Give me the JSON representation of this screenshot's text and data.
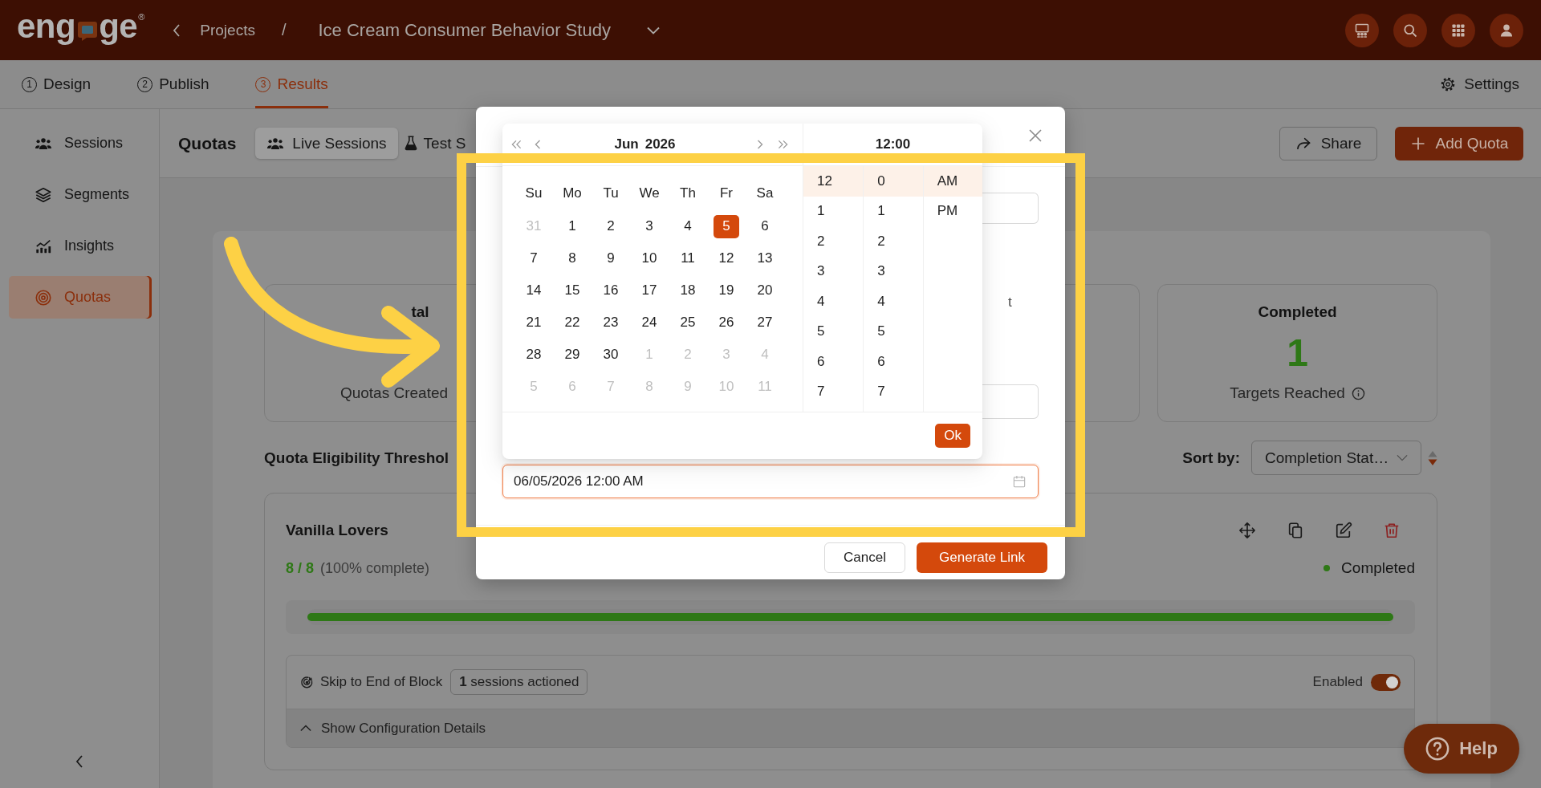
{
  "header": {
    "logo": {
      "before": "eng",
      "after": "ge",
      "mark": "®"
    },
    "breadcrumb": {
      "parent": "Projects",
      "separator": "/",
      "project": "Ice Cream Consumer Behavior Study"
    }
  },
  "steps": [
    {
      "number": "1",
      "label": "Design",
      "selected": false
    },
    {
      "number": "2",
      "label": "Publish",
      "selected": false
    },
    {
      "number": "3",
      "label": "Results",
      "selected": true
    }
  ],
  "settings": {
    "label": "Settings"
  },
  "sidebar": {
    "items": [
      {
        "label": "Sessions",
        "selected": false
      },
      {
        "label": "Segments",
        "selected": false
      },
      {
        "label": "Insights",
        "selected": false
      },
      {
        "label": "Quotas",
        "selected": true
      }
    ]
  },
  "toolbar": {
    "title": "Quotas",
    "session_tabs": [
      {
        "label": "Live Sessions",
        "selected": true
      },
      {
        "label": "Test S",
        "selected": false
      }
    ],
    "share": "Share",
    "add": "Add Quota"
  },
  "stats": [
    {
      "title": "tal",
      "subtitle": "Quotas Created",
      "info": false
    },
    {
      "title": "Completed",
      "value": "1",
      "subtitle": "Targets Reached",
      "info": true
    }
  ],
  "threshold": {
    "label": "Quota Eligibility Threshol"
  },
  "sort": {
    "label": "Sort by:",
    "value": "Completion Stat…"
  },
  "quotas": [
    {
      "name": "Vanilla Lovers",
      "count": "8 / 8",
      "percent": "(100% complete)",
      "status": {
        "label": "Completed",
        "kind": "completed"
      },
      "level": 1,
      "rule": {
        "action": "Skip to End of Block",
        "badge": "**1** sessions actioned",
        "toggle_label": "Enabled",
        "on": true
      },
      "details": "Show Configuration Details"
    }
  ],
  "help": "Help",
  "dialog": {
    "field_label": "t",
    "date_value": "06/05/2026 12:00 AM",
    "cancel": "Cancel",
    "submit": "Generate Link"
  },
  "date_picker": {
    "month": "Jun",
    "year": "2026",
    "time": "12:00",
    "weekdays": [
      "Su",
      "Mo",
      "Tu",
      "We",
      "Th",
      "Fr",
      "Sa"
    ],
    "weeks": [
      [
        {
          "day": "31",
          "in_month": false,
          "selected": false
        },
        {
          "day": "1",
          "in_month": true,
          "selected": false
        },
        {
          "day": "2",
          "in_month": true,
          "selected": false
        },
        {
          "day": "3",
          "in_month": true,
          "selected": false
        },
        {
          "day": "4",
          "in_month": true,
          "selected": false
        },
        {
          "day": "5",
          "in_month": true,
          "selected": true
        },
        {
          "day": "6",
          "in_month": true,
          "selected": false
        }
      ],
      [
        {
          "day": "7",
          "in_month": true,
          "selected": false
        },
        {
          "day": "8",
          "in_month": true,
          "selected": false
        },
        {
          "day": "9",
          "in_month": true,
          "selected": false
        },
        {
          "day": "10",
          "in_month": true,
          "selected": false
        },
        {
          "day": "11",
          "in_month": true,
          "selected": false
        },
        {
          "day": "12",
          "in_month": true,
          "selected": false
        },
        {
          "day": "13",
          "in_month": true,
          "selected": false
        }
      ],
      [
        {
          "day": "14",
          "in_month": true,
          "selected": false
        },
        {
          "day": "15",
          "in_month": true,
          "selected": false
        },
        {
          "day": "16",
          "in_month": true,
          "selected": false
        },
        {
          "day": "17",
          "in_month": true,
          "selected": false
        },
        {
          "day": "18",
          "in_month": true,
          "selected": false
        },
        {
          "day": "19",
          "in_month": true,
          "selected": false
        },
        {
          "day": "20",
          "in_month": true,
          "selected": false
        }
      ],
      [
        {
          "day": "21",
          "in_month": true,
          "selected": false
        },
        {
          "day": "22",
          "in_month": true,
          "selected": false
        },
        {
          "day": "23",
          "in_month": true,
          "selected": false
        },
        {
          "day": "24",
          "in_month": true,
          "selected": false
        },
        {
          "day": "25",
          "in_month": true,
          "selected": false
        },
        {
          "day": "26",
          "in_month": true,
          "selected": false
        },
        {
          "day": "27",
          "in_month": true,
          "selected": false
        }
      ],
      [
        {
          "day": "28",
          "in_month": true,
          "selected": false
        },
        {
          "day": "29",
          "in_month": true,
          "selected": false
        },
        {
          "day": "30",
          "in_month": true,
          "selected": false
        },
        {
          "day": "1",
          "in_month": false,
          "selected": false
        },
        {
          "day": "2",
          "in_month": false,
          "selected": false
        },
        {
          "day": "3",
          "in_month": false,
          "selected": false
        },
        {
          "day": "4",
          "in_month": false,
          "selected": false
        }
      ],
      [
        {
          "day": "5",
          "in_month": false,
          "selected": false
        },
        {
          "day": "6",
          "in_month": false,
          "selected": false
        },
        {
          "day": "7",
          "in_month": false,
          "selected": false
        },
        {
          "day": "8",
          "in_month": false,
          "selected": false
        },
        {
          "day": "9",
          "in_month": false,
          "selected": false
        },
        {
          "day": "10",
          "in_month": false,
          "selected": false
        },
        {
          "day": "11",
          "in_month": false,
          "selected": false
        }
      ]
    ],
    "hours": [
      {
        "label": "12",
        "selected": true
      },
      {
        "label": "1",
        "selected": false
      },
      {
        "label": "2",
        "selected": false
      },
      {
        "label": "3",
        "selected": false
      },
      {
        "label": "4",
        "selected": false
      },
      {
        "label": "5",
        "selected": false
      },
      {
        "label": "6",
        "selected": false
      },
      {
        "label": "7",
        "selected": false
      }
    ],
    "minutes": [
      {
        "label": "0",
        "selected": true
      },
      {
        "label": "1",
        "selected": false
      },
      {
        "label": "2",
        "selected": false
      },
      {
        "label": "3",
        "selected": false
      },
      {
        "label": "4",
        "selected": false
      },
      {
        "label": "5",
        "selected": false
      },
      {
        "label": "6",
        "selected": false
      },
      {
        "label": "7",
        "selected": false
      }
    ],
    "periods": [
      {
        "label": "AM",
        "selected": true
      },
      {
        "label": "PM",
        "selected": false
      }
    ],
    "ok": "Ok"
  },
  "annotations": {
    "arrow": true,
    "highlight_frame": true
  }
}
